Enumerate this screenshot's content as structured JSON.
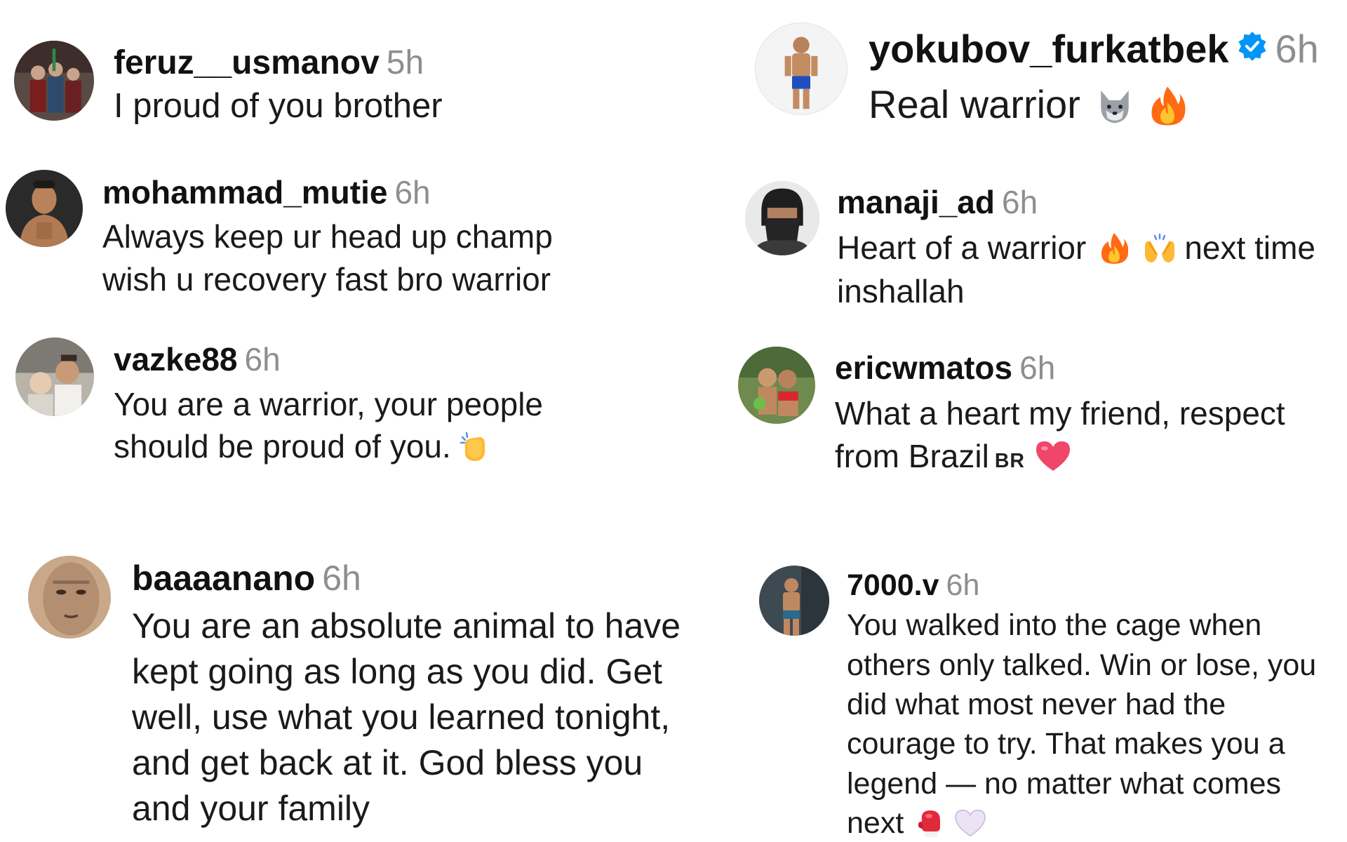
{
  "comments": {
    "c1": {
      "username": "feruz__usmanov",
      "time": "5h",
      "text": "I proud of you brother"
    },
    "c2": {
      "username": "mohammad_mutie",
      "time": "6h",
      "line1": "Always keep ur head up champ",
      "line2": "wish u recovery fast bro warrior"
    },
    "c3": {
      "username": "vazke88",
      "time": "6h",
      "line1": "You are a warrior, your people",
      "line2": "should be proud of you."
    },
    "c4": {
      "username": "baaaanano",
      "time": "6h",
      "lines": [
        "You are an absolute animal to have",
        "kept going as long as you did. Get",
        "well, use what you learned tonight,",
        "and get back at it. God bless you",
        "and your family"
      ]
    },
    "c5": {
      "username": "yokubov_furkatbek",
      "time": "6h",
      "text": "Real warrior"
    },
    "c6": {
      "username": "manaji_ad",
      "time": "6h",
      "text_a": "Heart of a warrior",
      "text_b": "next time",
      "line2": "inshallah"
    },
    "c7": {
      "username": "ericwmatos",
      "time": "6h",
      "line1": "What a heart my friend, respect",
      "line2": "from Brazil",
      "flag": "BR"
    },
    "c8": {
      "username": "7000.v",
      "time": "6h",
      "lines": [
        "You walked into the cage when",
        "others only talked. Win or lose, you",
        "did what most never had the",
        "courage to try. That makes you a",
        "legend — no matter what comes"
      ],
      "last_line": "next"
    }
  },
  "icons": {
    "verified": "verified-badge-icon",
    "wolf": "wolf-emoji",
    "fire": "fire-emoji",
    "raised_hands": "raising-hands-emoji",
    "clap": "clapping-hands-emoji",
    "heart": "red-heart-emoji",
    "glove": "boxing-glove-emoji",
    "white_heart": "white-heart-emoji"
  },
  "colors": {
    "verified_blue": "#0095f6",
    "timestamp_gray": "#8e8e8e",
    "fire_orange": "#ff6a13",
    "heart_red": "#f0466a"
  }
}
